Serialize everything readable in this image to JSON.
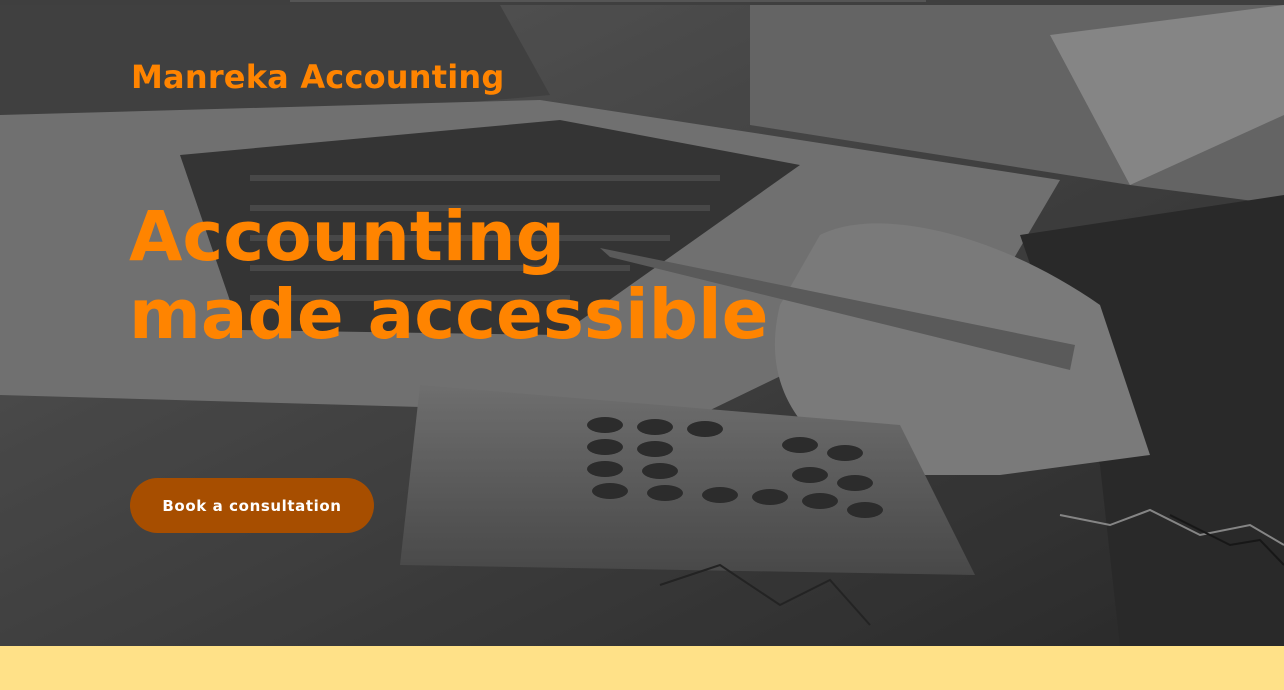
{
  "header": {
    "brand_name": "Manreka Accounting"
  },
  "hero": {
    "headline_line1": "Accounting",
    "headline_line2": "made accessible",
    "cta_label": "Book a consultation",
    "background_image": "laptop-calculator-pen-photo"
  },
  "colors": {
    "accent": "#ff8400",
    "button": "#a74e00",
    "band": "#ffe188"
  }
}
